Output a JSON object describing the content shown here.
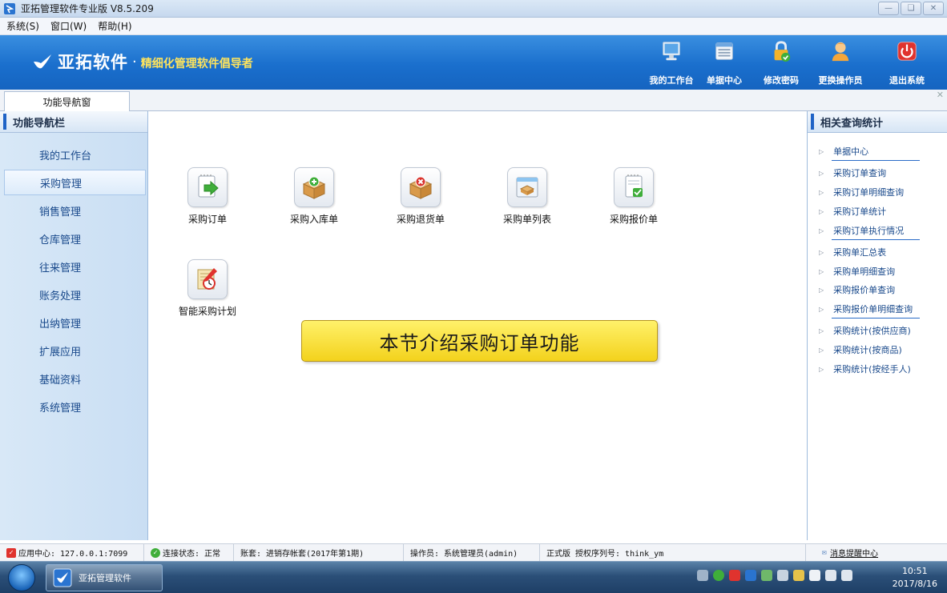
{
  "window": {
    "title": "亚拓管理软件专业版 V8.5.209",
    "controls": [
      "minimize-icon",
      "maximize-icon",
      "close-icon"
    ]
  },
  "menu": {
    "items": [
      "系统(S)",
      "窗口(W)",
      "帮助(H)"
    ]
  },
  "banner": {
    "brand": "亚拓软件",
    "dot": "·",
    "slogan": "精细化管理软件倡导者",
    "buttons": [
      {
        "label": "我的工作台",
        "icon": "monitor-icon"
      },
      {
        "label": "单据中心",
        "icon": "document-list-icon"
      },
      {
        "label": "修改密码",
        "icon": "lock-icon"
      },
      {
        "label": "更换操作员",
        "icon": "user-icon"
      },
      {
        "label": "退出系统",
        "icon": "power-icon"
      }
    ]
  },
  "tabs": {
    "active": "功能导航窗"
  },
  "left_nav": {
    "title": "功能导航栏",
    "items": [
      "我的工作台",
      "采购管理",
      "销售管理",
      "仓库管理",
      "往来管理",
      "账务处理",
      "出纳管理",
      "扩展应用",
      "基础资料",
      "系统管理"
    ],
    "active_index": 1
  },
  "main": {
    "functions": [
      {
        "label": "采购订单",
        "icon": "purchase-order-icon"
      },
      {
        "label": "采购入库单",
        "icon": "stock-in-box-icon"
      },
      {
        "label": "采购退货单",
        "icon": "return-box-icon"
      },
      {
        "label": "采购单列表",
        "icon": "order-list-icon"
      },
      {
        "label": "采购报价单",
        "icon": "quotation-icon"
      },
      {
        "label": "智能采购计划",
        "icon": "purchase-plan-icon"
      }
    ],
    "callout": "本节介绍采购订单功能"
  },
  "right_panel": {
    "title": "相关查询统计",
    "links": [
      "单据中心",
      "采购订单查询",
      "采购订单明细查询",
      "采购订单统计",
      "采购订单执行情况",
      "采购单汇总表",
      "采购单明细查询",
      "采购报价单查询",
      "采购报价单明细查询",
      "采购统计(按供应商)",
      "采购统计(按商品)",
      "采购统计(按经手人)"
    ]
  },
  "status_bar": {
    "app_center": "应用中心: 127.0.0.1:7099",
    "connection": "连接状态: 正常",
    "account": "账套: 进销存帐套(2017年第1期)",
    "operator": "操作员: 系统管理员(admin)",
    "license": "正式版 授权序列号: think_ym",
    "messages": "消息提醒中心"
  },
  "taskbar": {
    "app_label": "亚拓管理软件",
    "time": "10:51",
    "date": "2017/8/16"
  },
  "colors": {
    "banner": "#1a6fcd",
    "slogan": "#ffe45c",
    "nav_text": "#1a4a8c",
    "callout": "#f3d21c"
  }
}
